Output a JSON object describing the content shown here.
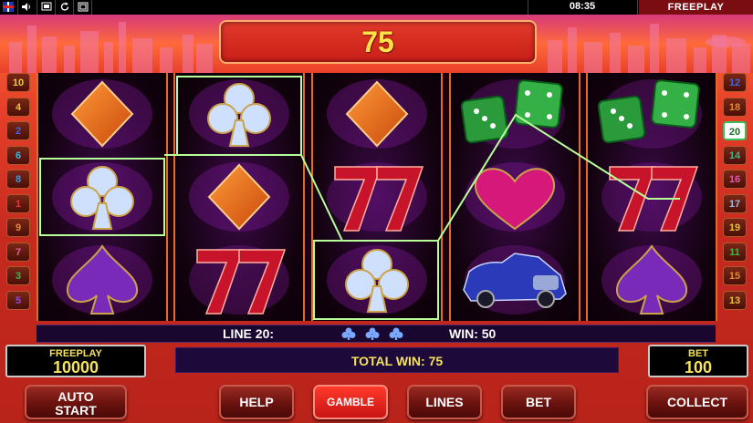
{
  "topbar": {
    "clock": "08:35",
    "mode_label": "FREEPLAY",
    "icons": [
      "uk-flag-icon",
      "sound-icon",
      "screen-icon",
      "refresh-icon",
      "fullscreen-icon"
    ]
  },
  "win_display": {
    "value": "75"
  },
  "lines_left": [
    "10",
    "4",
    "2",
    "6",
    "8",
    "1",
    "9",
    "7",
    "3",
    "5"
  ],
  "lines_right": [
    "12",
    "18",
    "20",
    "14",
    "16",
    "17",
    "19",
    "11",
    "15",
    "13"
  ],
  "active_line": "20",
  "reels": [
    [
      "diamond",
      "club",
      "spade"
    ],
    [
      "club",
      "diamond",
      "seven"
    ],
    [
      "diamond",
      "seven",
      "club"
    ],
    [
      "dice",
      "heart",
      "car"
    ],
    [
      "dice",
      "seven",
      "spade"
    ]
  ],
  "info_bar": {
    "line_label": "LINE 20:",
    "win_label": "WIN: 50",
    "line_symbols": [
      "club",
      "club",
      "club"
    ]
  },
  "credit_panel": {
    "label": "FREEPLAY",
    "value": "10000"
  },
  "total_win": {
    "label": "TOTAL WIN: 75"
  },
  "bet_panel": {
    "label": "BET",
    "value": "100"
  },
  "buttons": {
    "auto_start_line1": "AUTO",
    "auto_start_line2": "START",
    "help": "HELP",
    "gamble": "GAMBLE",
    "lines": "LINES",
    "bet": "BET",
    "collect": "COLLECT"
  },
  "colors": {
    "win_text": "#ffe24a",
    "line_highlight": "#b8ff9a",
    "panel_text": "#f5e25a"
  }
}
